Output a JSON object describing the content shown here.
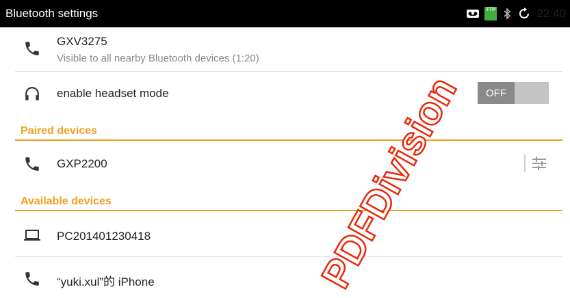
{
  "statusbar": {
    "title": "Bluetooth settings",
    "ftp_badge": "FTP",
    "time": "22:40"
  },
  "device": {
    "name": "GXV3275",
    "visibility": "Visible to all nearby Bluetooth devices (1:20)"
  },
  "headset": {
    "label": "enable headset mode",
    "toggle_state": "OFF"
  },
  "paired": {
    "title": "Paired devices",
    "items": [
      {
        "name": "GXP2200",
        "icon": "phone-icon"
      }
    ]
  },
  "available": {
    "title": "Available devices",
    "items": [
      {
        "name": "PC201401230418",
        "icon": "laptop-icon"
      },
      {
        "name": "“yuki.xul”的 iPhone",
        "icon": "phone-icon"
      }
    ]
  },
  "watermark": {
    "text": "PDFDivision"
  },
  "colors": {
    "accent": "#f0a020",
    "watermark": "#e8280a",
    "statusbar": "#000000"
  }
}
